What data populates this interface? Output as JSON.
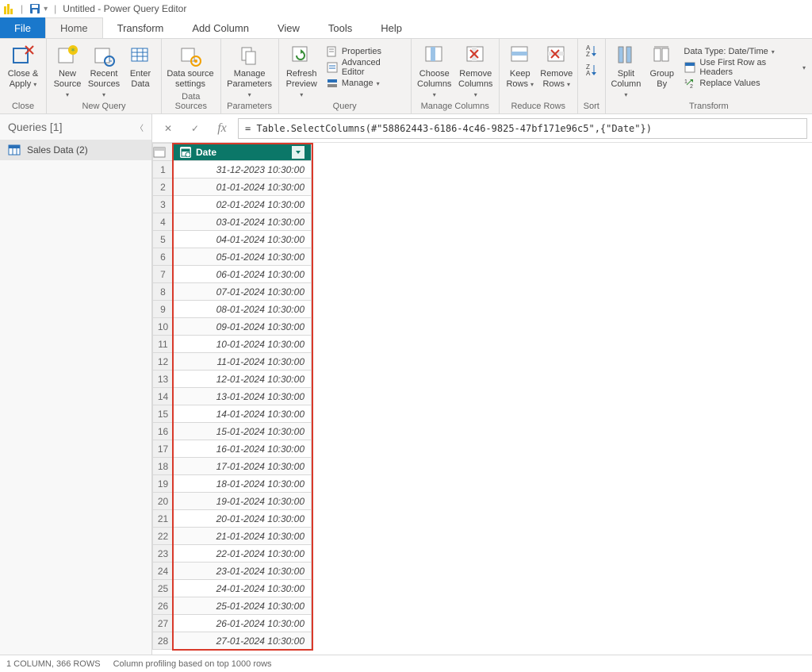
{
  "titlebar": {
    "title": "Untitled - Power Query Editor"
  },
  "tabs": {
    "file": "File",
    "home": "Home",
    "transform": "Transform",
    "add_column": "Add Column",
    "view": "View",
    "tools": "Tools",
    "help": "Help"
  },
  "ribbon": {
    "close": {
      "close_apply": "Close & Apply",
      "group": "Close"
    },
    "newquery": {
      "new_source": "New Source",
      "recent_sources": "Recent Sources",
      "enter_data": "Enter Data",
      "group": "New Query"
    },
    "datasources": {
      "data_source_settings": "Data source settings",
      "group": "Data Sources"
    },
    "parameters": {
      "manage_parameters": "Manage Parameters",
      "group": "Parameters"
    },
    "query": {
      "refresh_preview": "Refresh Preview",
      "properties": "Properties",
      "advanced_editor": "Advanced Editor",
      "manage": "Manage",
      "group": "Query"
    },
    "managecols": {
      "choose_columns": "Choose Columns",
      "remove_columns": "Remove Columns",
      "group": "Manage Columns"
    },
    "reducerows": {
      "keep_rows": "Keep Rows",
      "remove_rows": "Remove Rows",
      "group": "Reduce Rows"
    },
    "sort": {
      "group": "Sort"
    },
    "transform": {
      "split_column": "Split Column",
      "group_by": "Group By",
      "data_type": "Data Type: Date/Time",
      "first_row_headers": "Use First Row as Headers",
      "replace_values": "Replace Values",
      "group": "Transform"
    }
  },
  "queries": {
    "header": "Queries [1]",
    "item": "Sales Data (2)"
  },
  "formula": "= Table.SelectColumns(#\"58862443-6186-4c46-9825-47bf171e96c5\",{\"Date\"})",
  "column_header": "Date",
  "rows": [
    "31-12-2023 10:30:00",
    "01-01-2024 10:30:00",
    "02-01-2024 10:30:00",
    "03-01-2024 10:30:00",
    "04-01-2024 10:30:00",
    "05-01-2024 10:30:00",
    "06-01-2024 10:30:00",
    "07-01-2024 10:30:00",
    "08-01-2024 10:30:00",
    "09-01-2024 10:30:00",
    "10-01-2024 10:30:00",
    "11-01-2024 10:30:00",
    "12-01-2024 10:30:00",
    "13-01-2024 10:30:00",
    "14-01-2024 10:30:00",
    "15-01-2024 10:30:00",
    "16-01-2024 10:30:00",
    "17-01-2024 10:30:00",
    "18-01-2024 10:30:00",
    "19-01-2024 10:30:00",
    "20-01-2024 10:30:00",
    "21-01-2024 10:30:00",
    "22-01-2024 10:30:00",
    "23-01-2024 10:30:00",
    "24-01-2024 10:30:00",
    "25-01-2024 10:30:00",
    "26-01-2024 10:30:00",
    "27-01-2024 10:30:00"
  ],
  "status": {
    "cols_rows": "1 COLUMN, 366 ROWS",
    "profiling": "Column profiling based on top 1000 rows"
  }
}
